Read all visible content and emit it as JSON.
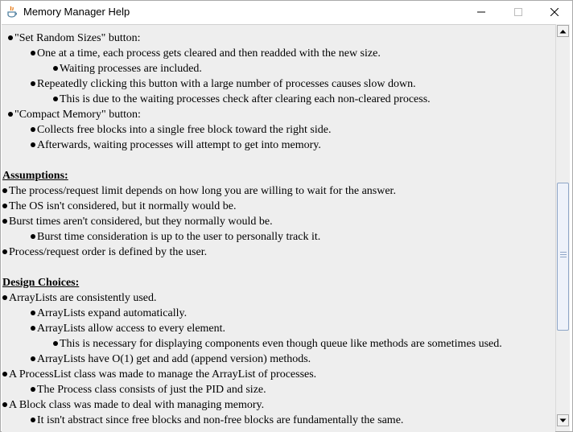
{
  "window": {
    "title": "Memory Manager Help"
  },
  "content": {
    "lines": [
      {
        "text": "\"Set Random Sizes\" button:",
        "level": 1,
        "bullet": true
      },
      {
        "text": "One at a time, each process gets cleared and then readded with the new size.",
        "level": 2,
        "bullet": true
      },
      {
        "text": "Waiting processes are included.",
        "level": 3,
        "bullet": true
      },
      {
        "text": "Repeatedly clicking this button with a large number of processes causes slow down.",
        "level": 2,
        "bullet": true
      },
      {
        "text": "This is due to the waiting processes check after clearing each non-cleared process.",
        "level": 3,
        "bullet": true
      },
      {
        "text": "\"Compact Memory\" button:",
        "level": 1,
        "bullet": true
      },
      {
        "text": "Collects free blocks into a single free block toward the right side.",
        "level": 2,
        "bullet": true
      },
      {
        "text": "Afterwards, waiting processes will attempt to get into memory.",
        "level": 2,
        "bullet": true
      },
      {
        "text": "",
        "level": 0,
        "bullet": false
      },
      {
        "text": "Assumptions:",
        "level": 0,
        "bullet": false,
        "heading": true
      },
      {
        "text": "The process/request limit depends on how long you are willing to wait for the answer.",
        "level": 0,
        "bullet": true
      },
      {
        "text": "The OS isn't considered, but it normally would be.",
        "level": 0,
        "bullet": true
      },
      {
        "text": "Burst times aren't considered, but they normally would be.",
        "level": 0,
        "bullet": true
      },
      {
        "text": "Burst time consideration is up to the user to personally track it.",
        "level": 2,
        "bullet": true
      },
      {
        "text": "Process/request order is defined by the user.",
        "level": 0,
        "bullet": true
      },
      {
        "text": "",
        "level": 0,
        "bullet": false
      },
      {
        "text": "Design Choices:",
        "level": 0,
        "bullet": false,
        "heading": true
      },
      {
        "text": "ArrayLists are consistently used.",
        "level": 0,
        "bullet": true
      },
      {
        "text": "ArrayLists expand automatically.",
        "level": 2,
        "bullet": true
      },
      {
        "text": "ArrayLists allow access to every element.",
        "level": 2,
        "bullet": true
      },
      {
        "text": "This is necessary for displaying components even though queue like methods are sometimes used.",
        "level": 3,
        "bullet": true
      },
      {
        "text": "ArrayLists have O(1) get and add (append version) methods.",
        "level": 2,
        "bullet": true
      },
      {
        "text": "A ProcessList class was made to manage the ArrayList of processes.",
        "level": 0,
        "bullet": true
      },
      {
        "text": "The Process class consists of just the PID and size.",
        "level": 2,
        "bullet": true
      },
      {
        "text": "A Block class was made to deal with managing memory.",
        "level": 0,
        "bullet": true
      },
      {
        "text": "It isn't abstract since free blocks and non-free blocks are fundamentally the same.",
        "level": 2,
        "bullet": true
      }
    ]
  },
  "icons": {
    "app": "java-cup-icon",
    "minimize": "minimize-icon",
    "maximize": "maximize-icon",
    "close": "close-icon",
    "scroll_up": "arrow-up-icon",
    "scroll_down": "arrow-down-icon"
  }
}
